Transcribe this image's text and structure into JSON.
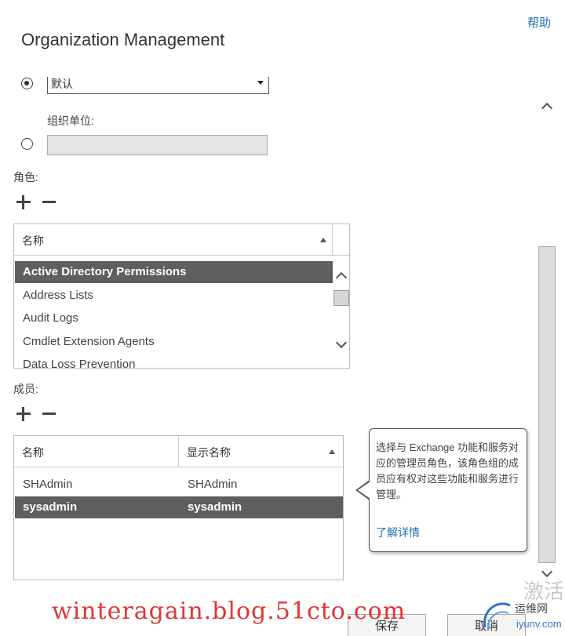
{
  "header": {
    "title": "Organization Management",
    "help_label": "帮助"
  },
  "scope": {
    "default_select_value": "默认",
    "org_unit_label": "组织单位:",
    "org_unit_value": ""
  },
  "roles": {
    "label": "角色:",
    "column_name": "名称",
    "items": [
      {
        "name": "Active Directory Permissions",
        "selected": true
      },
      {
        "name": "Address Lists",
        "selected": false
      },
      {
        "name": "Audit Logs",
        "selected": false
      },
      {
        "name": "Cmdlet Extension Agents",
        "selected": false
      },
      {
        "name": "Data Loss Prevention",
        "selected": false
      }
    ]
  },
  "members": {
    "label": "成员:",
    "column_name": "名称",
    "column_display_name": "显示名称",
    "rows": [
      {
        "name": "SHAdmin",
        "display_name": "SHAdmin",
        "selected": false
      },
      {
        "name": "sysadmin",
        "display_name": "sysadmin",
        "selected": true
      }
    ]
  },
  "tooltip": {
    "text": "选择与 Exchange 功能和服务对应的管理员角色，该角色组的成员应有权对这些功能和服务进行管理。",
    "link_label": "了解详情"
  },
  "footer": {
    "save_label": "保存",
    "cancel_label": "取消"
  },
  "watermarks": {
    "activate": "激活",
    "blog": "winteragain.blog.51cto.com",
    "logo_line1": "运维网",
    "logo_line2": "iyunv.com"
  },
  "colors": {
    "accent": "#1f6fb5",
    "selected_row": "#5f5f5f",
    "watermark_red": "#e03535"
  }
}
